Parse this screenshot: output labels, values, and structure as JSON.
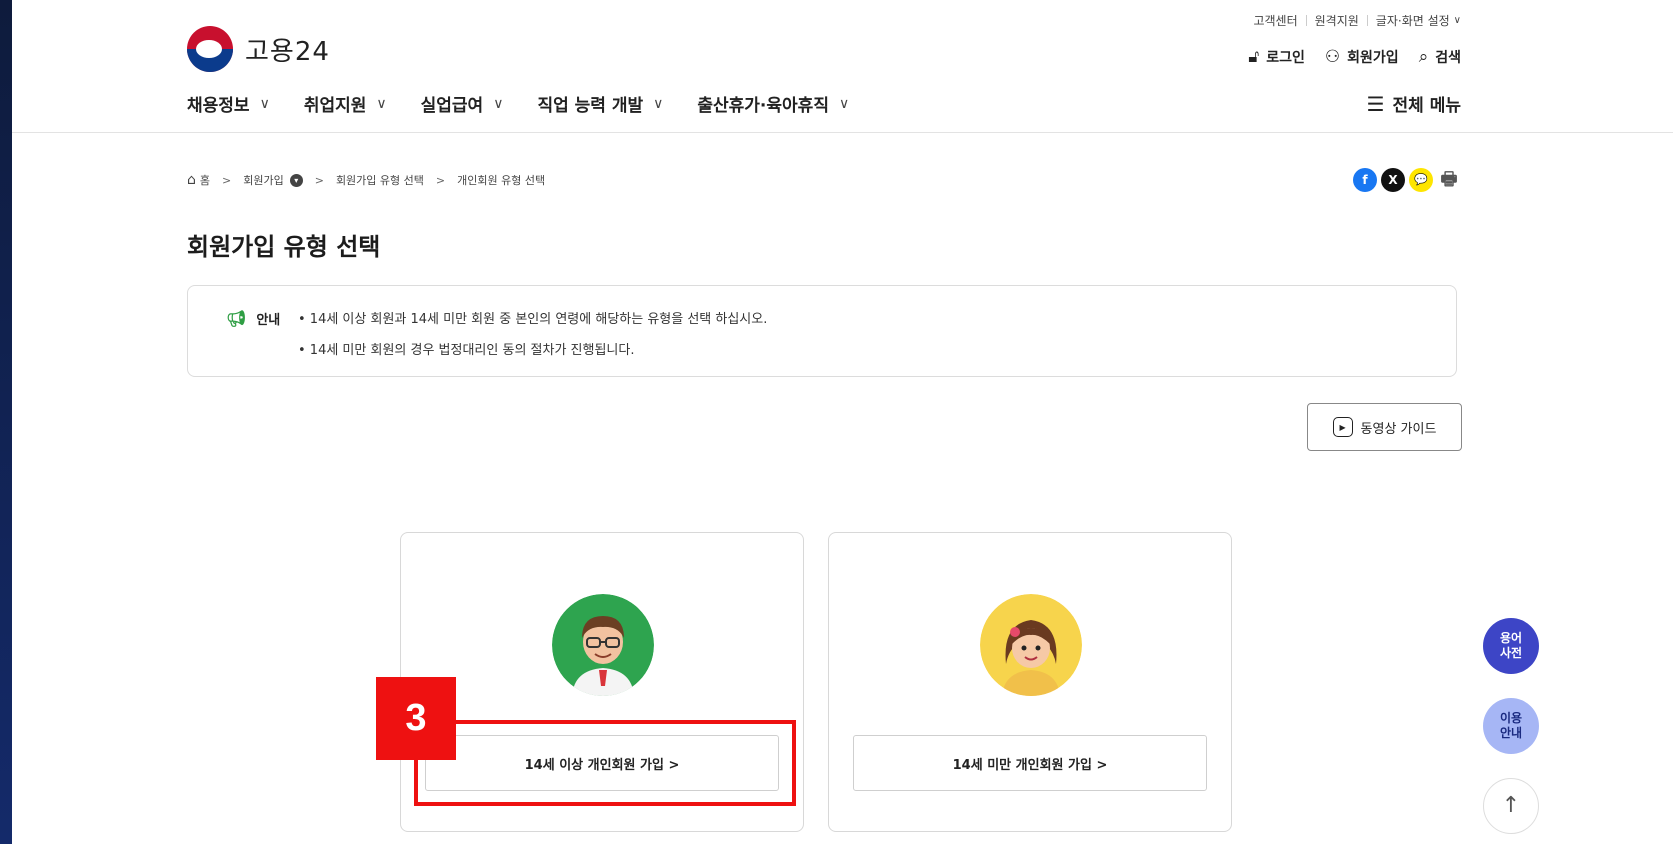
{
  "utility": {
    "links": [
      "고객센터",
      "원격지원",
      "글자·화면 설정"
    ],
    "dropdown_chevron": "∨"
  },
  "logo": {
    "text": "고용24"
  },
  "member_links": [
    {
      "icon": "lock-icon",
      "glyph": "🔓︎",
      "label": "로그인"
    },
    {
      "icon": "add-user-icon",
      "glyph": "⚇",
      "label": "회원가입"
    },
    {
      "icon": "search-icon",
      "glyph": "⌕",
      "label": "검색"
    }
  ],
  "gnb": {
    "items": [
      "채용정보",
      "취업지원",
      "실업급여",
      "직업 능력 개발",
      "출산휴가·육아휴직"
    ],
    "chevron": "∨",
    "all_menu_label": "전체 메뉴"
  },
  "breadcrumb": {
    "items": [
      "홈",
      "회원가입",
      "회원가입 유형 선택",
      "개인회원 유형 선택"
    ],
    "separator": ">"
  },
  "share": [
    {
      "icon": "facebook-icon",
      "glyph": "f",
      "color": "#1877f2"
    },
    {
      "icon": "x-icon",
      "glyph": "X",
      "color": "#111111"
    },
    {
      "icon": "kakaotalk-icon",
      "glyph": "💬",
      "color": "#fee500"
    },
    {
      "icon": "print-icon",
      "glyph": "🖶",
      "color": "#555555"
    }
  ],
  "page_title": "회원가입 유형 선택",
  "notice": {
    "label": "안내",
    "lines": [
      "• 14세 이상 회원과 14세 미만 회원 중 본인의 연령에 해당하는 유형을 선택 하십시오.",
      "• 14세 미만 회원의 경우 법정대리인 동의 절차가 진행됩니다."
    ]
  },
  "video_guide": {
    "label": "동영상 가이드"
  },
  "cards": [
    {
      "id": "adult",
      "button_label": "14세 이상 개인회원 가입  >"
    },
    {
      "id": "child",
      "button_label": "14세 미만 개인회원 가입  >"
    }
  ],
  "step_badge": "3",
  "floating": {
    "dictionary": "용어\n사전",
    "guide": "이용\n안내",
    "top_glyph": "↑"
  },
  "colors": {
    "accent_green": "#2f9e44",
    "highlight_red": "#ee1111",
    "float_blue": "#3d45c6",
    "float_light": "#a6b6f5"
  }
}
